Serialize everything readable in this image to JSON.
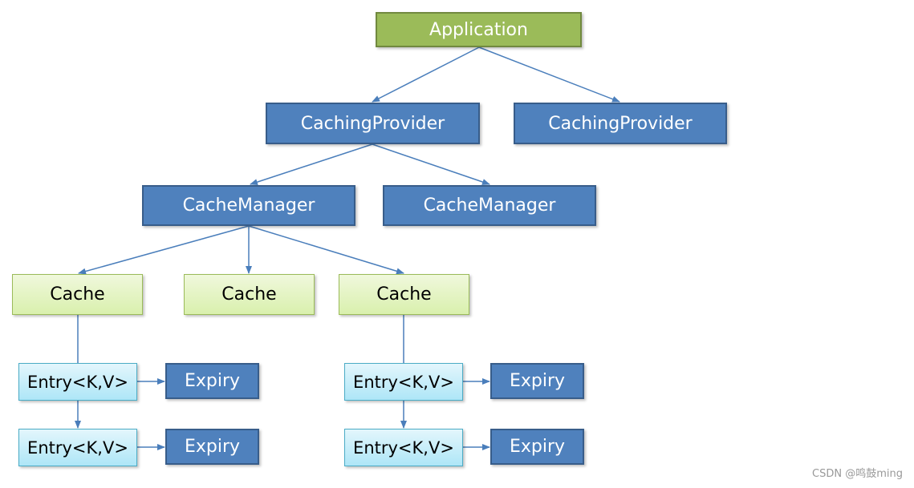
{
  "nodes": {
    "application": "Application",
    "caching_providers": [
      "CachingProvider",
      "CachingProvider"
    ],
    "cache_managers": [
      "CacheManager",
      "CacheManager"
    ],
    "caches": [
      "Cache",
      "Cache",
      "Cache"
    ],
    "entries": [
      "Entry<K,V>",
      "Entry<K,V>",
      "Entry<K,V>",
      "Entry<K,V>"
    ],
    "expiries": [
      "Expiry",
      "Expiry",
      "Expiry",
      "Expiry"
    ]
  },
  "colors": {
    "application": "#9bbb59",
    "blue_node": "#4f81bd",
    "cache": "#d9f0ad",
    "entry": "#aee6f7",
    "arrow": "#4a7ebb"
  },
  "watermark": "CSDN @鸣鼓ming"
}
